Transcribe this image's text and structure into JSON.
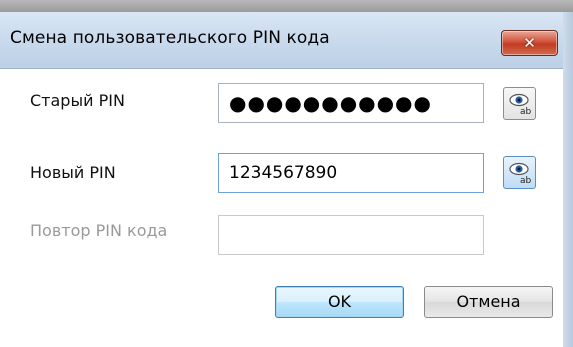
{
  "window": {
    "title": "Смена пользовательского PIN кода",
    "close_label": "✕"
  },
  "fields": {
    "old_pin": {
      "label": "Старый PIN",
      "value": "●●●●●●●●●●●"
    },
    "new_pin": {
      "label": "Новый PIN",
      "value": "1234567890"
    },
    "repeat_pin": {
      "label": "Повтор PIN кода",
      "value": ""
    }
  },
  "buttons": {
    "ok": "OK",
    "cancel": "Отмена"
  },
  "icons": {
    "show_old": "eye-icon",
    "show_new": "eye-icon"
  },
  "colors": {
    "close_button": "#c94a32",
    "accent": "#3c7fb1"
  }
}
